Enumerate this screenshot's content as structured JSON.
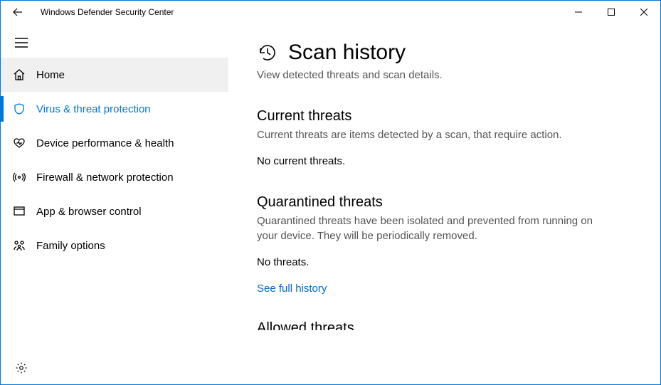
{
  "window": {
    "title": "Windows Defender Security Center"
  },
  "sidebar": {
    "items": [
      {
        "label": "Home"
      },
      {
        "label": "Virus & threat protection"
      },
      {
        "label": "Device performance & health"
      },
      {
        "label": "Firewall & network protection"
      },
      {
        "label": "App & browser control"
      },
      {
        "label": "Family options"
      }
    ]
  },
  "main": {
    "title": "Scan history",
    "subtitle": "View detected threats and scan details.",
    "sections": {
      "current": {
        "title": "Current threats",
        "desc": "Current threats are items detected by a scan, that require action.",
        "body": "No current threats."
      },
      "quarantined": {
        "title": "Quarantined threats",
        "desc": "Quarantined threats have been isolated and prevented from running on your device.  They will be periodically removed.",
        "body": "No threats.",
        "link": "See full history"
      },
      "allowed": {
        "title_partial": "Allowed threats"
      }
    }
  }
}
